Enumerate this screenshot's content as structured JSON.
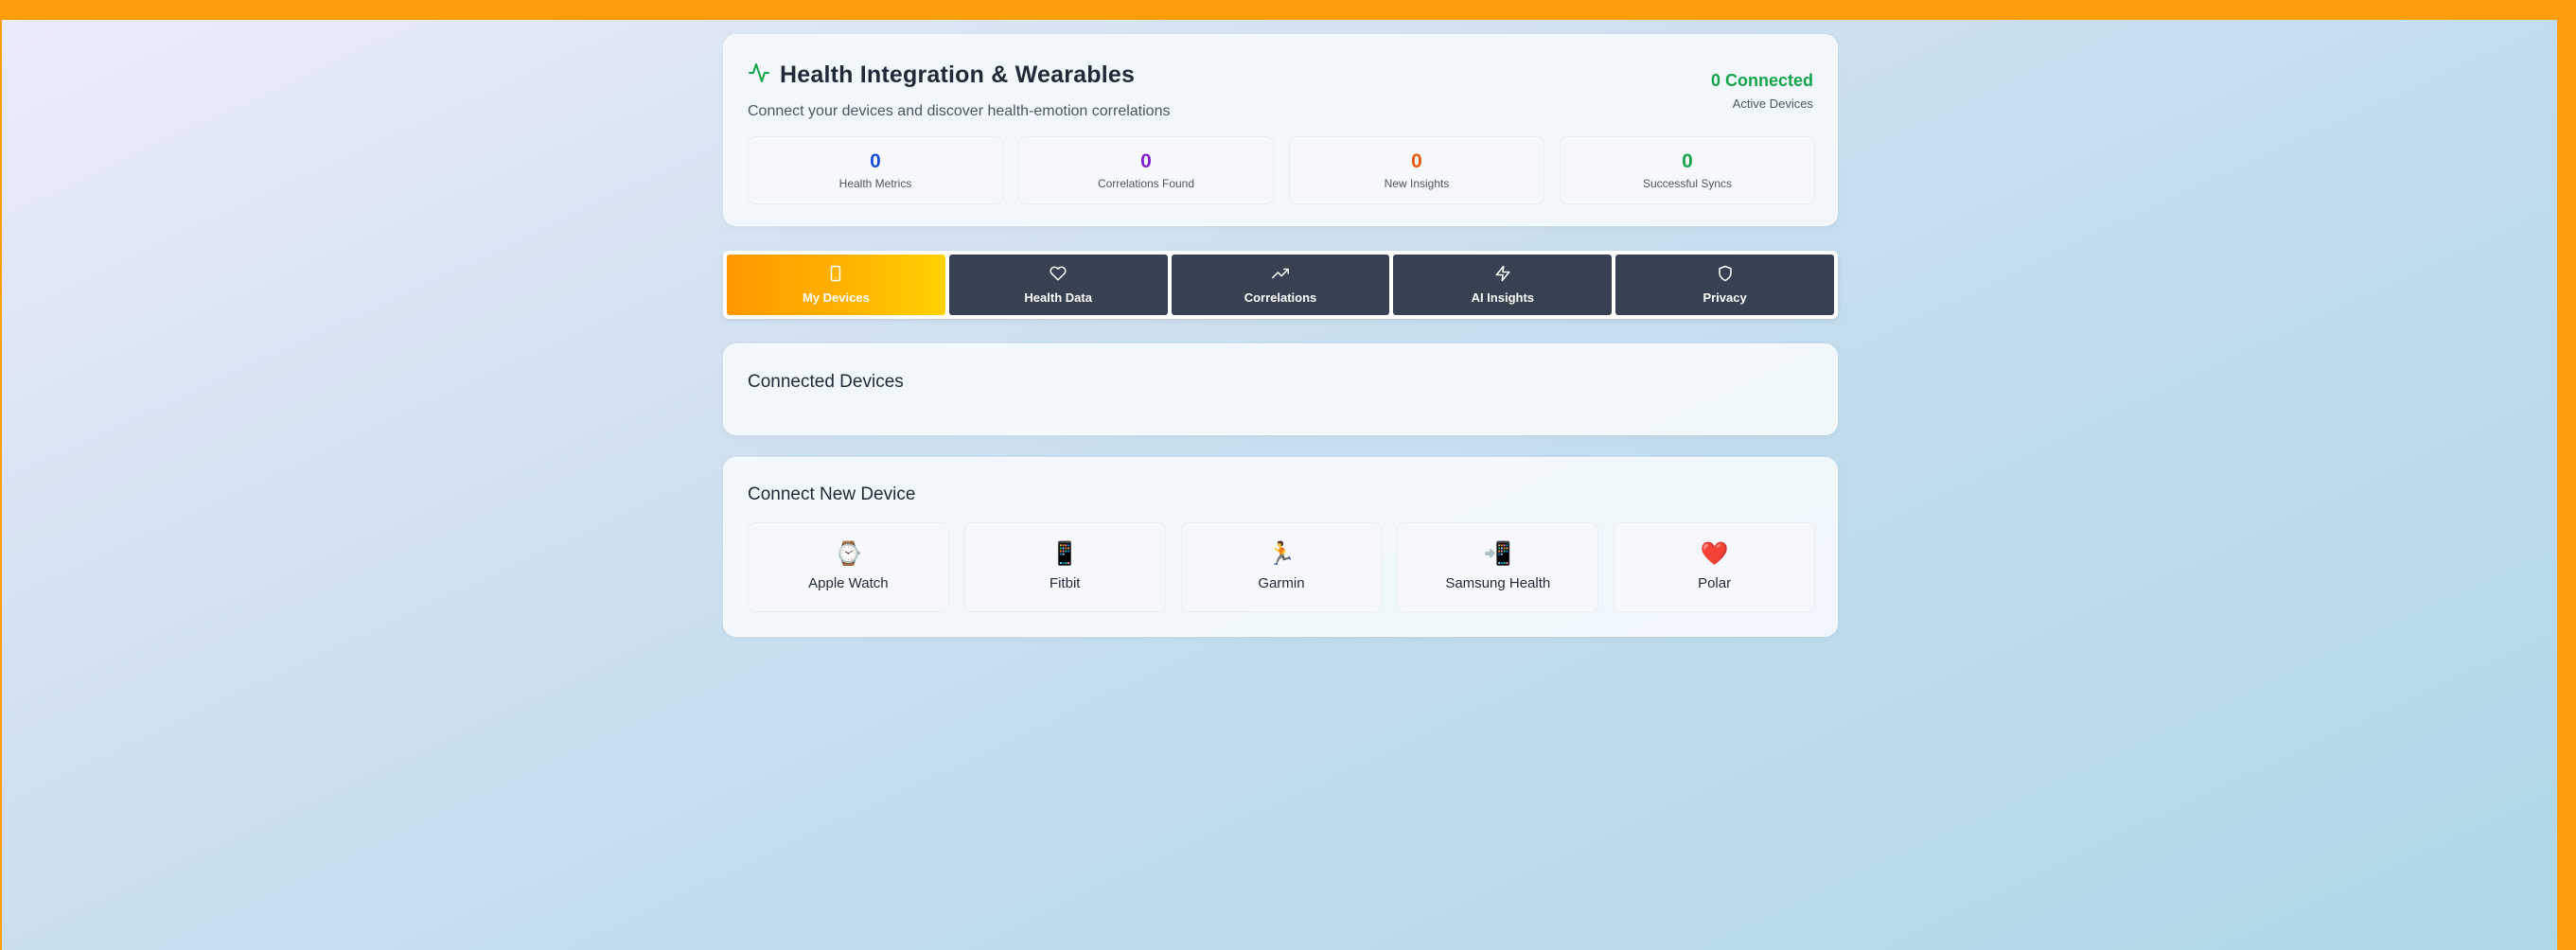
{
  "header": {
    "title": "Health Integration & Wearables",
    "subtitle": "Connect your devices and discover health-emotion correlations",
    "status_count": "0 Connected",
    "status_label": "Active Devices"
  },
  "stats": [
    {
      "value": "0",
      "label": "Health Metrics",
      "color": "#1d4ed8"
    },
    {
      "value": "0",
      "label": "Correlations Found",
      "color": "#7e22ce"
    },
    {
      "value": "0",
      "label": "New Insights",
      "color": "#ea580c"
    },
    {
      "value": "0",
      "label": "Successful Syncs",
      "color": "#16a34a"
    }
  ],
  "tabs": [
    {
      "label": "My Devices",
      "icon": "smartphone-icon",
      "active": true
    },
    {
      "label": "Health Data",
      "icon": "heart-icon",
      "active": false
    },
    {
      "label": "Correlations",
      "icon": "trending-up-icon",
      "active": false
    },
    {
      "label": "AI Insights",
      "icon": "zap-icon",
      "active": false
    },
    {
      "label": "Privacy",
      "icon": "shield-icon",
      "active": false
    }
  ],
  "connected_section": {
    "title": "Connected Devices"
  },
  "new_device_section": {
    "title": "Connect New Device",
    "devices": [
      {
        "name": "Apple Watch",
        "emoji": "⌚"
      },
      {
        "name": "Fitbit",
        "emoji": "📱"
      },
      {
        "name": "Garmin",
        "emoji": "🏃"
      },
      {
        "name": "Samsung Health",
        "emoji": "📲"
      },
      {
        "name": "Polar",
        "emoji": "❤️"
      }
    ]
  },
  "colors": {
    "accent": "#ff9800",
    "frame": "#ff9e0b",
    "tab_dark": "#374151",
    "success": "#16a34a"
  }
}
